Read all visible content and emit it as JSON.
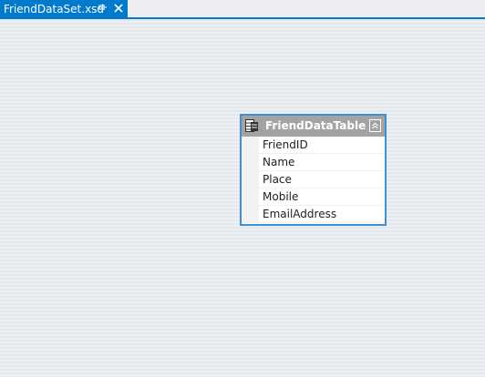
{
  "tab": {
    "title": "FriendDataSet.xsd",
    "accent_color": "#007acc",
    "pin_icon": "pin-icon",
    "close_icon": "close-icon"
  },
  "datatable": {
    "name": "FriendDataTable",
    "icon": "datatable-icon",
    "collapse_icon": "collapse-up-icon",
    "border_color": "#3f8fd2",
    "header_color": "#a3a3a3",
    "columns": [
      "FriendID",
      "Name",
      "Place",
      "Mobile",
      "EmailAddress"
    ]
  }
}
